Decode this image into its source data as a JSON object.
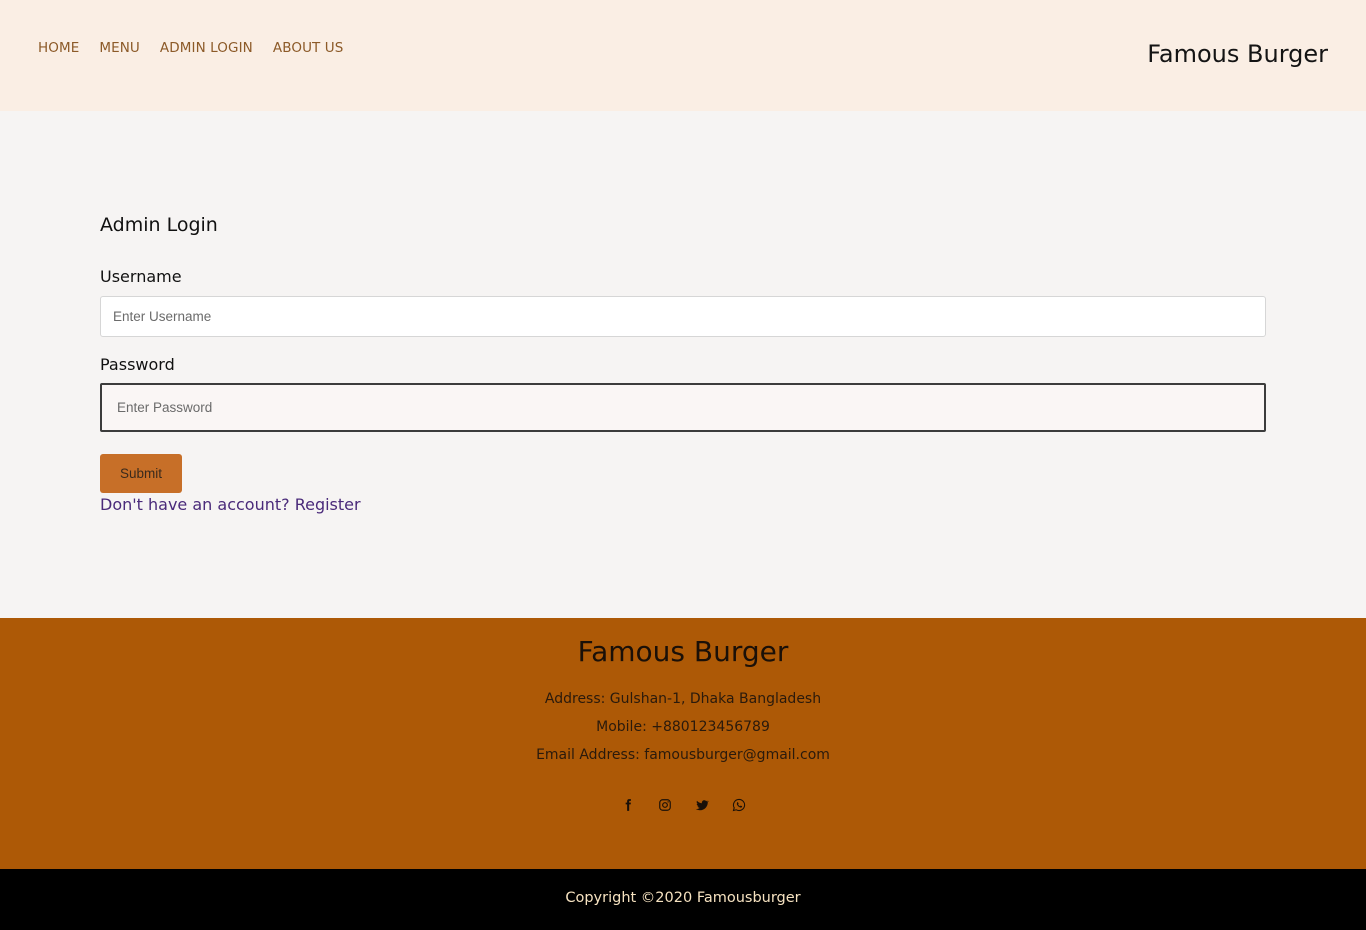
{
  "header": {
    "nav": {
      "home": "HOME",
      "menu": "MENU",
      "admin_login": "ADMIN LOGIN",
      "about_us": "ABOUT US"
    },
    "brand": "Famous Burger"
  },
  "form": {
    "title": "Admin Login",
    "username_label": "Username",
    "username_placeholder": "Enter Username",
    "password_label": "Password",
    "password_placeholder": "Enter Password",
    "submit_label": "Submit",
    "register_text": "Don't have an account? Register"
  },
  "footer": {
    "title": "Famous Burger",
    "address": "Address: Gulshan-1, Dhaka Bangladesh",
    "mobile": "Mobile: +880123456789",
    "email": "Email Address: famousburger@gmail.com",
    "socials": [
      "facebook-icon",
      "instagram-icon",
      "twitter-icon",
      "whatsapp-icon"
    ]
  },
  "copyright": "Copyright ©2020 Famousburger",
  "colors": {
    "header_bg": "#faeee4",
    "nav_link": "#8c5a28",
    "footer_bg": "#ad5906",
    "submit_bg": "#c76f28",
    "register_link": "#4a2a7a",
    "copyright_bg": "#000000",
    "copyright_text": "#f6e2c0"
  }
}
